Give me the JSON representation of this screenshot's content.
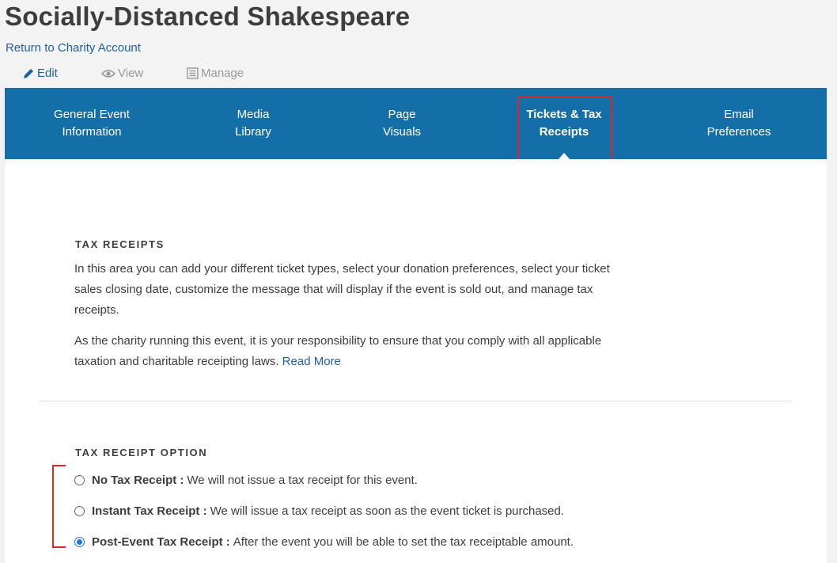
{
  "page": {
    "title": "Socially-Distanced Shakespeare",
    "return_link": "Return to Charity Account"
  },
  "modes": {
    "edit": "Edit",
    "view": "View",
    "manage": "Manage"
  },
  "tabs": [
    {
      "line1": "General Event",
      "line2": "Information"
    },
    {
      "line1": "Media",
      "line2": "Library"
    },
    {
      "line1": "Page",
      "line2": "Visuals"
    },
    {
      "line1": "Tickets & Tax",
      "line2": "Receipts"
    },
    {
      "line1": "Email",
      "line2": "Preferences"
    }
  ],
  "active_tab": "Tickets & Tax Receipts",
  "tax_receipts": {
    "heading": "TAX RECEIPTS",
    "paragraph1": "In this area you can add your different ticket types, select your donation preferences, select your ticket sales closing date, customize the message that will display if the event is sold out, and manage tax receipts.",
    "paragraph2": "As the charity running this event, it is your responsibility to ensure that you comply with all applicable taxation and charitable receipting laws.",
    "read_more": "Read More"
  },
  "tax_receipt_option": {
    "heading": "TAX RECEIPT OPTION",
    "options": [
      {
        "label": "No Tax Receipt :",
        "description": "We will not issue a tax receipt for this event.",
        "selected": false
      },
      {
        "label": "Instant Tax Receipt :",
        "description": "We will issue a tax receipt as soon as the event ticket is purchased.",
        "selected": false
      },
      {
        "label": "Post-Event Tax Receipt :",
        "description": "After the event you will be able to set the tax receiptable amount.",
        "selected": true
      }
    ]
  },
  "colors": {
    "tab_bar": "#146fa9",
    "link": "#1f5f9e",
    "annotation": "#d9262b",
    "radio_selected": "#1a73e8"
  }
}
